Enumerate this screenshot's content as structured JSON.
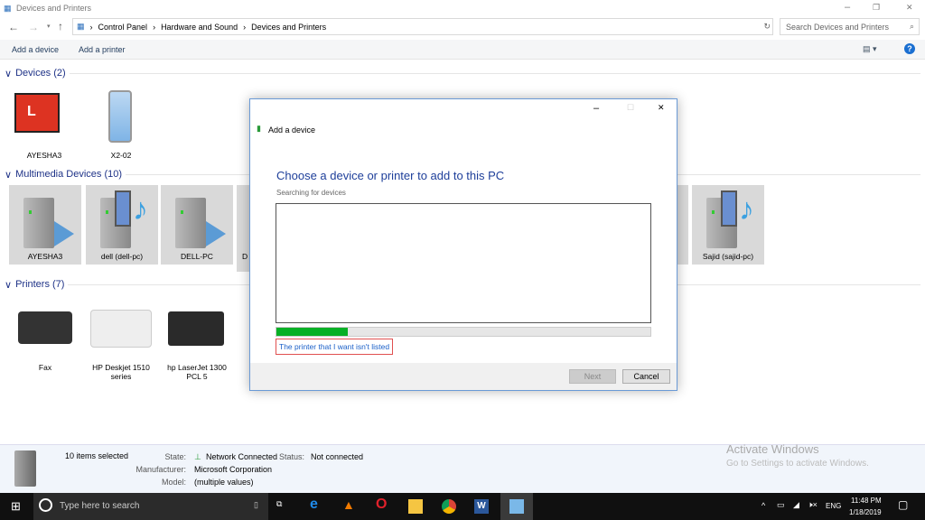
{
  "window": {
    "title": "Devices and Printers",
    "min": "–",
    "max": "❐",
    "close": "✕"
  },
  "address": {
    "crumbs": [
      "Control Panel",
      "Hardware and Sound",
      "Devices and Printers"
    ],
    "search_placeholder": "Search Devices and Printers"
  },
  "toolbar": {
    "add_device": "Add a device",
    "add_printer": "Add a printer",
    "help": "?"
  },
  "groups": {
    "devices": "Devices (2)",
    "multimedia": "Multimedia Devices (10)",
    "printers": "Printers (7)"
  },
  "devices": [
    "AYESHA3",
    "X2-02"
  ],
  "multimedia": [
    "AYESHA3",
    "dell (dell-pc)",
    "DELL-PC",
    "D",
    "Sajid (sajid-pc)"
  ],
  "printers": [
    "Fax",
    "HP Deskjet 1510 series",
    "hp LaserJet 1300 PCL 5"
  ],
  "dialog": {
    "title": "Add a device",
    "heading": "Choose a device or printer to add to this PC",
    "subtitle": "Searching for devices",
    "progress": 0.19,
    "link": "The printer that I want isn't listed",
    "next": "Next",
    "cancel": "Cancel",
    "accent": "#06b025"
  },
  "status": {
    "selected": "10 items selected",
    "state_label": "State:",
    "state": "Network Connected",
    "status_label": "Status:",
    "status": "Not connected",
    "mfr_label": "Manufacturer:",
    "mfr": "Microsoft Corporation",
    "model_label": "Model:",
    "model": "(multiple values)"
  },
  "watermark": {
    "title": "Activate Windows",
    "sub": "Go to Settings to activate Windows."
  },
  "taskbar": {
    "search": "Type here to search",
    "lang": "ENG",
    "time": "11:48 PM",
    "date": "1/18/2019"
  }
}
